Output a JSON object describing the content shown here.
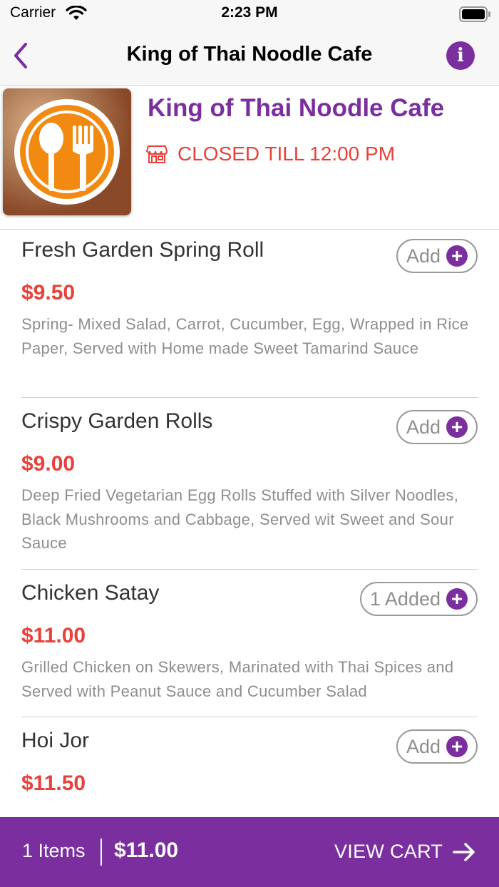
{
  "status_bar": {
    "carrier": "Carrier",
    "time": "2:23 PM"
  },
  "nav": {
    "title": "King of Thai Noodle Cafe",
    "info_label": "i"
  },
  "restaurant": {
    "name": "King of Thai Noodle Cafe",
    "status": "CLOSED TILL 12:00 PM"
  },
  "menu_items": [
    {
      "name": "Fresh Garden Spring Roll",
      "price": "$9.50",
      "description": "Spring- Mixed Salad, Carrot, Cucumber, Egg, Wrapped in Rice Paper, Served with Home made Sweet Tamarind Sauce",
      "button_label": "Add"
    },
    {
      "name": "Crispy Garden Rolls",
      "price": "$9.00",
      "description": "Deep Fried Vegetarian Egg Rolls Stuffed with Silver Noodles, Black Mushrooms and Cabbage, Served wit Sweet and Sour Sauce",
      "button_label": "Add"
    },
    {
      "name": "Chicken Satay",
      "price": "$11.00",
      "description": "Grilled Chicken on Skewers, Marinated with Thai Spices and Served with Peanut Sauce and Cucumber Salad",
      "button_label": "1 Added"
    },
    {
      "name": "Hoi Jor",
      "price": "$11.50",
      "description": "",
      "button_label": "Add"
    }
  ],
  "plus_symbol": "+",
  "cart": {
    "count_label": "1 Items",
    "total": "$11.00",
    "action_label": "VIEW CART"
  },
  "colors": {
    "brand": "#7b2e9e",
    "price": "#e8413a",
    "muted": "#8e8e8e"
  }
}
